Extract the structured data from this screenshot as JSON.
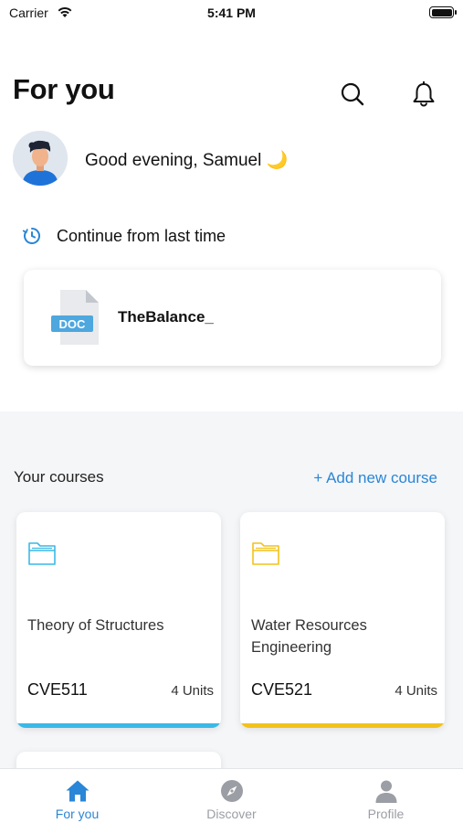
{
  "status_bar": {
    "carrier": "Carrier",
    "time": "5:41 PM"
  },
  "header": {
    "title": "For you",
    "icons": [
      "search-icon",
      "bell-icon"
    ]
  },
  "greeting": {
    "text": "Good evening, Samuel 🌙"
  },
  "continue_section": {
    "label": "Continue from last time",
    "icon": "clock-icon",
    "document": {
      "badge": "DOC",
      "name": "TheBalance_"
    }
  },
  "courses": {
    "title": "Your courses",
    "add_label": "+ Add new course",
    "items": [
      {
        "name": "Theory of Structures",
        "code": "CVE511",
        "units": "4 Units",
        "color": "#3bb9e6"
      },
      {
        "name": "Water Resources Engineering",
        "code": "CVE521",
        "units": "4 Units",
        "color": "#f2c21b"
      }
    ]
  },
  "tab_bar": {
    "tabs": [
      {
        "label": "For you",
        "icon": "home-icon",
        "active": true
      },
      {
        "label": "Discover",
        "icon": "compass-icon",
        "active": false
      },
      {
        "label": "Profile",
        "icon": "person-icon",
        "active": false
      }
    ],
    "active_color": "#2a86d6",
    "inactive_color": "#9b9ea4"
  }
}
